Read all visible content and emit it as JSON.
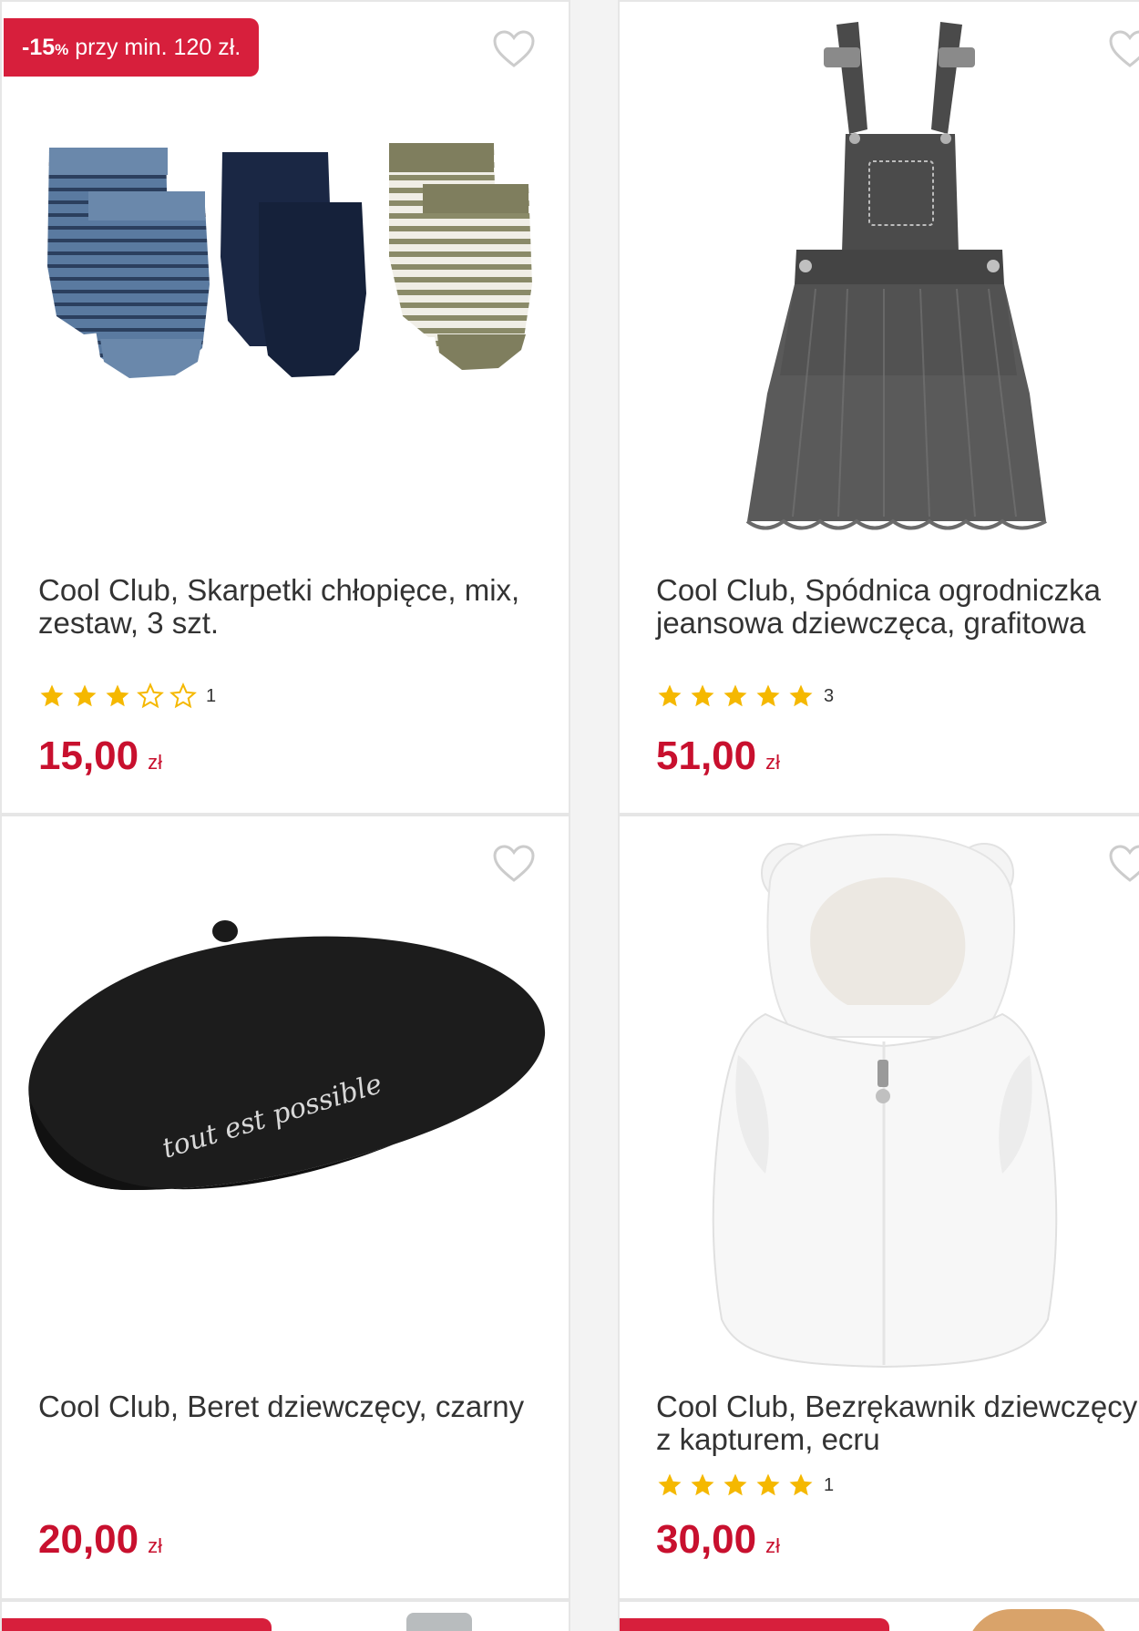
{
  "products": [
    {
      "promo": {
        "bold": "-15",
        "pct": "%",
        "text": " przy min. 120 zł."
      },
      "title_line1": "Cool Club, Skarpetki chłopięce, mix,",
      "title_line2": "zestaw, 3 szt.",
      "rating": 3,
      "rating_max": 5,
      "reviews": "1",
      "price": "15,00",
      "currency": "zł"
    },
    {
      "title_line1": "Cool Club, Spódnica ogrodniczka",
      "title_line2": "jeansowa dziewczęca, grafitowa",
      "rating": 5,
      "rating_max": 5,
      "reviews": "3",
      "price": "51,00",
      "currency": "zł"
    },
    {
      "title_line1": "Cool Club, Beret dziewczęcy, czarny",
      "title_line2": "",
      "price": "20,00",
      "currency": "zł"
    },
    {
      "title_line1": "Cool Club, Bezrękawnik dziewczęcy",
      "title_line2": "z kapturem, ecru",
      "rating": 5,
      "rating_max": 5,
      "reviews": "1",
      "price": "30,00",
      "currency": "zł"
    }
  ],
  "beret_embroidery": "tout est possible",
  "colors": {
    "accent": "#d71f3c",
    "price": "#c8102e",
    "star": "#f5b800",
    "heart": "#cccccc"
  },
  "icons": {
    "wishlist": "heart-outline-icon",
    "rating_full": "star-filled-icon",
    "rating_empty": "star-outline-icon"
  }
}
